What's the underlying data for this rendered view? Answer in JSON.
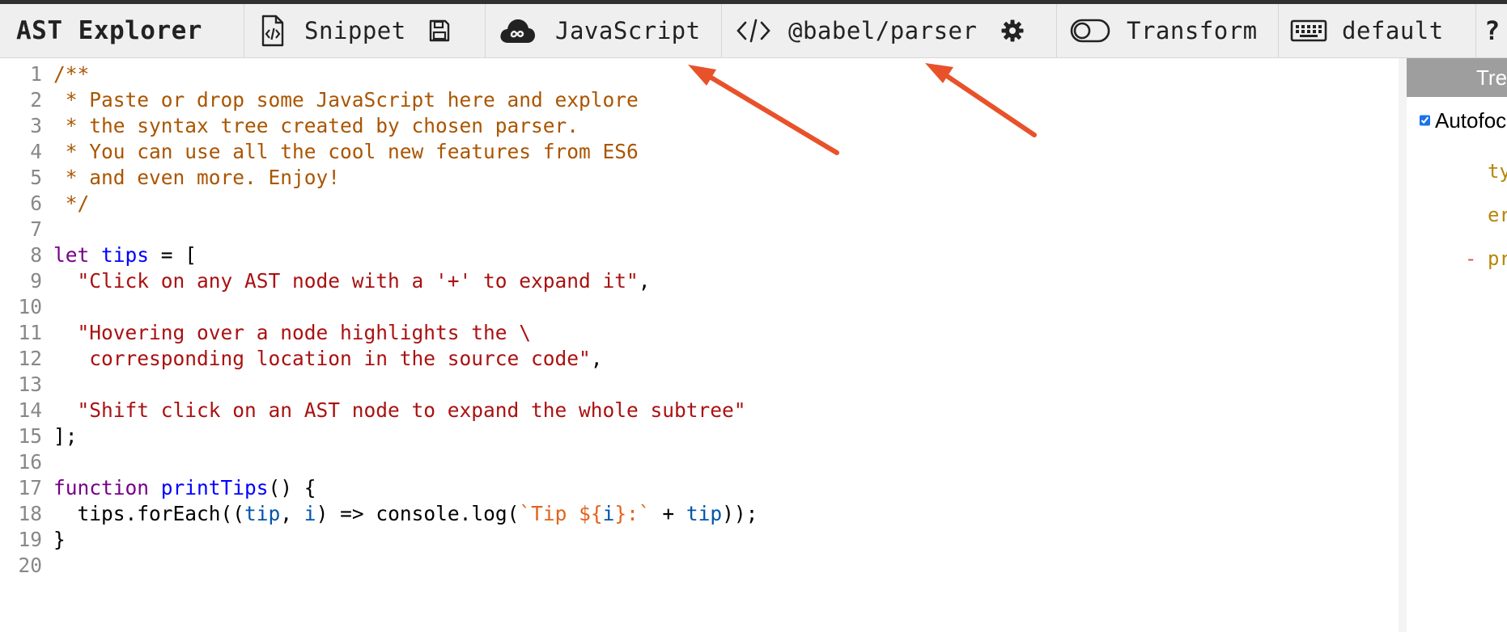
{
  "toolbar": {
    "brand": "AST Explorer",
    "snippet_label": "Snippet",
    "language_label": "JavaScript",
    "parser_label": "@babel/parser",
    "transform_label": "Transform",
    "keymap_label": "default",
    "help_label": "?"
  },
  "editor": {
    "lines": [
      {
        "n": "1"
      },
      {
        "n": "2"
      },
      {
        "n": "3"
      },
      {
        "n": "4"
      },
      {
        "n": "5"
      },
      {
        "n": "6"
      },
      {
        "n": "7"
      },
      {
        "n": "8"
      },
      {
        "n": "9"
      },
      {
        "n": "10"
      },
      {
        "n": "11"
      },
      {
        "n": "12"
      },
      {
        "n": "13"
      },
      {
        "n": "14"
      },
      {
        "n": "15"
      },
      {
        "n": "16"
      },
      {
        "n": "17"
      },
      {
        "n": "18"
      },
      {
        "n": "19"
      },
      {
        "n": "20"
      }
    ],
    "code": {
      "l1": "/**",
      "l2": " * Paste or drop some JavaScript here and explore",
      "l3": " * the syntax tree created by chosen parser.",
      "l4": " * You can use all the cool new features from ES6",
      "l5": " * and even more. Enjoy!",
      "l6": " */",
      "l8_kw": "let",
      "l8_def": "tips",
      "l8_rest": " = [",
      "l9": "  \"Click on any AST node with a '+' to expand it\"",
      "l9_tail": ",",
      "l11": "  \"Hovering over a node highlights the \\",
      "l12": "   corresponding location in the source code\"",
      "l12_tail": ",",
      "l14": "  \"Shift click on an AST node to expand the whole subtree\"",
      "l15": "];",
      "l17_kw": "function",
      "l17_def": "printTips",
      "l17_rest": "() {",
      "l18_a": "  tips.forEach((",
      "l18_tip": "tip",
      "l18_b": ", ",
      "l18_i": "i",
      "l18_c": ") => console.log(",
      "l18_tpl1": "`Tip ${",
      "l18_tpl_i": "i",
      "l18_tpl2": "}:`",
      "l18_d": " + ",
      "l18_tip2": "tip",
      "l18_e": "));",
      "l19": "}"
    }
  },
  "right_panel": {
    "tab_label": "Tree",
    "autofocus_label": "Autofocus",
    "autofocus_checked": true,
    "tree_lines": [
      "ty",
      "er",
      "pr"
    ],
    "minus_glyph": "-"
  },
  "colors": {
    "annotation_arrow": "#e8522a",
    "comment": "#aa5500",
    "keyword": "#770088",
    "definition": "#0000ff",
    "string": "#aa1111",
    "template": "#e2631d"
  }
}
